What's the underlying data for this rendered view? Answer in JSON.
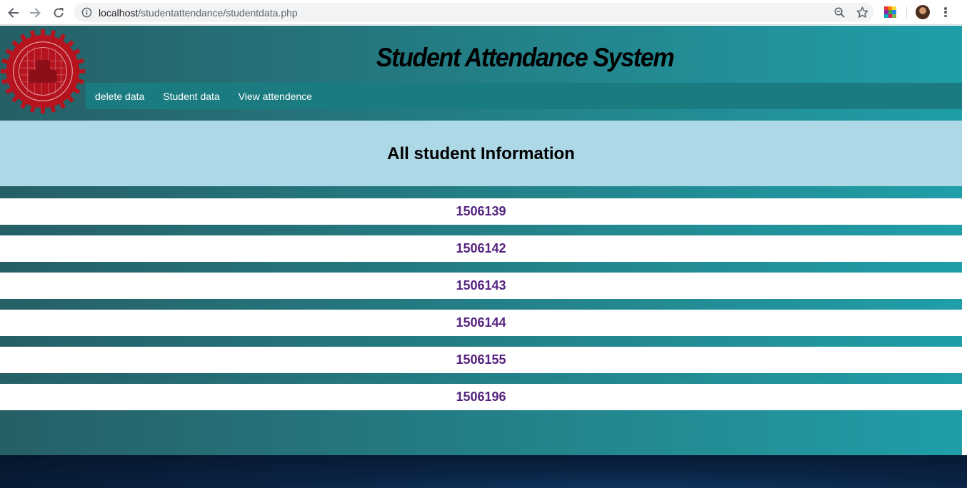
{
  "browser": {
    "url_host": "localhost",
    "url_path": "/studentattendance/studentdata.php"
  },
  "icons": {
    "back": "arrow-left-icon",
    "forward": "arrow-right-icon",
    "reload": "reload-icon",
    "info": "info-icon",
    "zoom": "zoom-out-icon",
    "bookmark": "star-icon",
    "extension": "color-grid-extension-icon",
    "profile": "avatar",
    "menu": "kebab-menu-icon"
  },
  "site": {
    "title": "Student Attendance System",
    "logo": "university-seal-logo"
  },
  "nav": {
    "items": [
      {
        "label": "delete data"
      },
      {
        "label": "Student data"
      },
      {
        "label": "View attendence"
      }
    ]
  },
  "main": {
    "heading": "All student Information",
    "students": [
      {
        "id": "1506139"
      },
      {
        "id": "1506142"
      },
      {
        "id": "1506143"
      },
      {
        "id": "1506144"
      },
      {
        "id": "1506155"
      },
      {
        "id": "1506196"
      }
    ]
  },
  "colors": {
    "header_gradient_start": "#265f66",
    "header_gradient_end": "#209ea8",
    "navbar": "#1a7b80",
    "info_panel": "#add8e6",
    "link": "#55237f"
  }
}
